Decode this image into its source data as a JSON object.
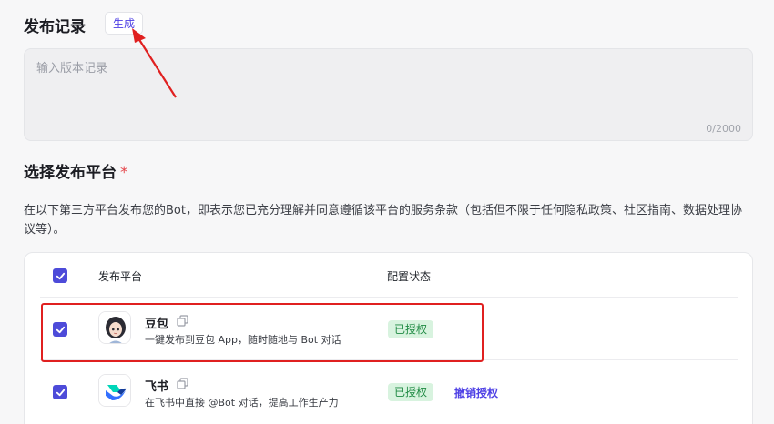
{
  "release_record": {
    "title": "发布记录",
    "generate_label": "生成",
    "placeholder": "输入版本记录",
    "counter": "0/2000"
  },
  "platform_select": {
    "title": "选择发布平台",
    "required_mark": "*",
    "description": "在以下第三方平台发布您的Bot，即表示您已充分理解并同意遵循该平台的服务条款（包括但不限于任何隐私政策、社区指南、数据处理协议等）。"
  },
  "table": {
    "col_platform": "发布平台",
    "col_status": "配置状态",
    "rows": [
      {
        "name": "豆包",
        "desc": "一键发布到豆包 App，随时随地与 Bot 对话",
        "status": "已授权",
        "action": "",
        "checked": true,
        "icon": "doubao-avatar-icon"
      },
      {
        "name": "飞书",
        "desc": "在飞书中直接 @Bot 对话，提高工作生产力",
        "status": "已授权",
        "action": "撤销授权",
        "checked": true,
        "icon": "feishu-logo-icon"
      }
    ]
  },
  "colors": {
    "accent": "#4e40e5",
    "checkbox": "#4d4bd9",
    "status_bg": "#d8f3df",
    "status_text": "#1f8a43",
    "annotation": "#e02020"
  }
}
